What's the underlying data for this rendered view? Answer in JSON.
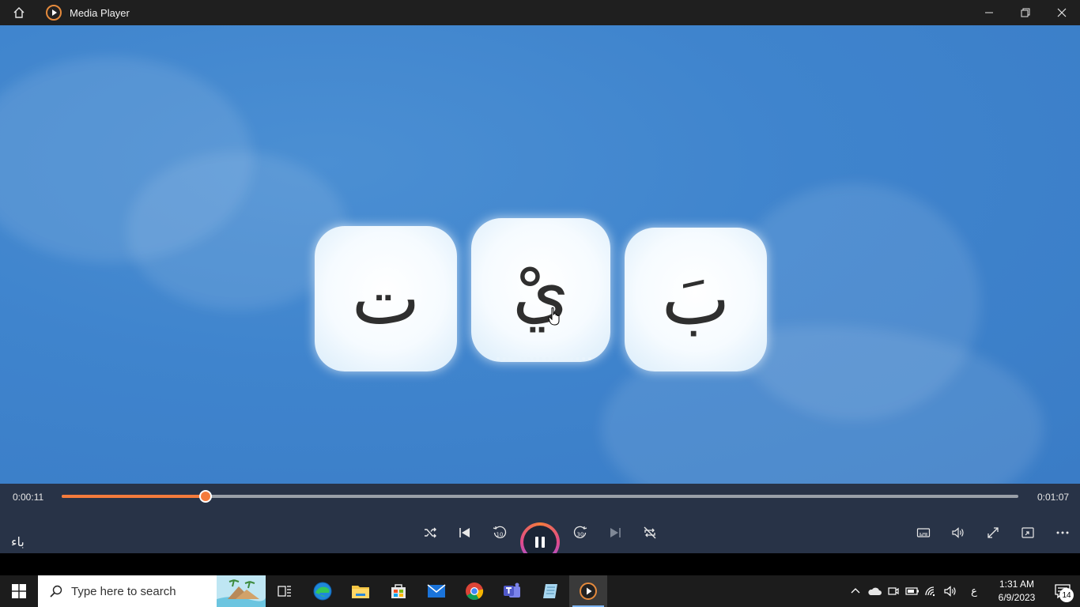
{
  "window": {
    "title": "Media Player"
  },
  "video": {
    "letters": [
      "ت",
      "يْ",
      "بَ"
    ]
  },
  "player": {
    "elapsed": "0:00:11",
    "duration": "0:01:07",
    "progress": 0.15,
    "accent": "#f47b3c",
    "now_playing_label": "باء"
  },
  "taskbar": {
    "search_placeholder": "Type here to search",
    "apps": [
      "task-view",
      "edge",
      "file-explorer",
      "microsoft-store",
      "mail",
      "chrome",
      "teams",
      "notepad",
      "media-player"
    ],
    "input_language": "ع",
    "time": "1:31 AM",
    "date": "6/9/2023",
    "notification_count": "14"
  }
}
